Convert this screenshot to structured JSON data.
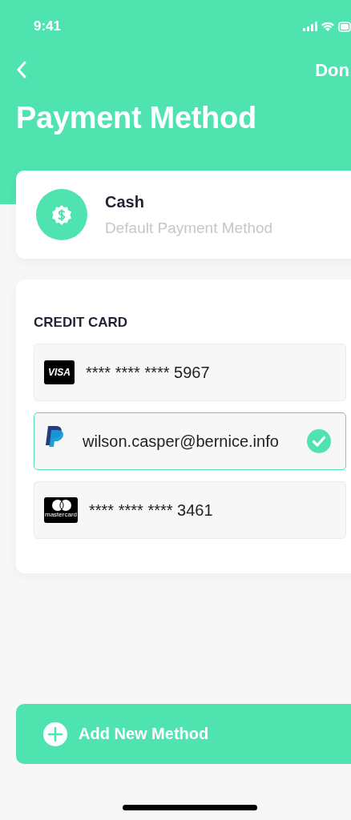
{
  "status_bar": {
    "time": "9:41"
  },
  "nav": {
    "action": "Don"
  },
  "title": "Payment Method",
  "cash": {
    "name": "Cash",
    "subtitle": "Default Payment Method"
  },
  "credit_card": {
    "heading": "CREDIT CARD",
    "methods": [
      {
        "kind": "visa",
        "logo_text": "VISA",
        "label": "**** **** **** 5967",
        "selected": false
      },
      {
        "kind": "paypal",
        "label": "wilson.casper@bernice.info",
        "selected": true
      },
      {
        "kind": "mastercard",
        "logo_text": "mastercard",
        "label": "**** **** **** 3461",
        "selected": false
      }
    ]
  },
  "add_button": {
    "label": "Add New Method"
  }
}
